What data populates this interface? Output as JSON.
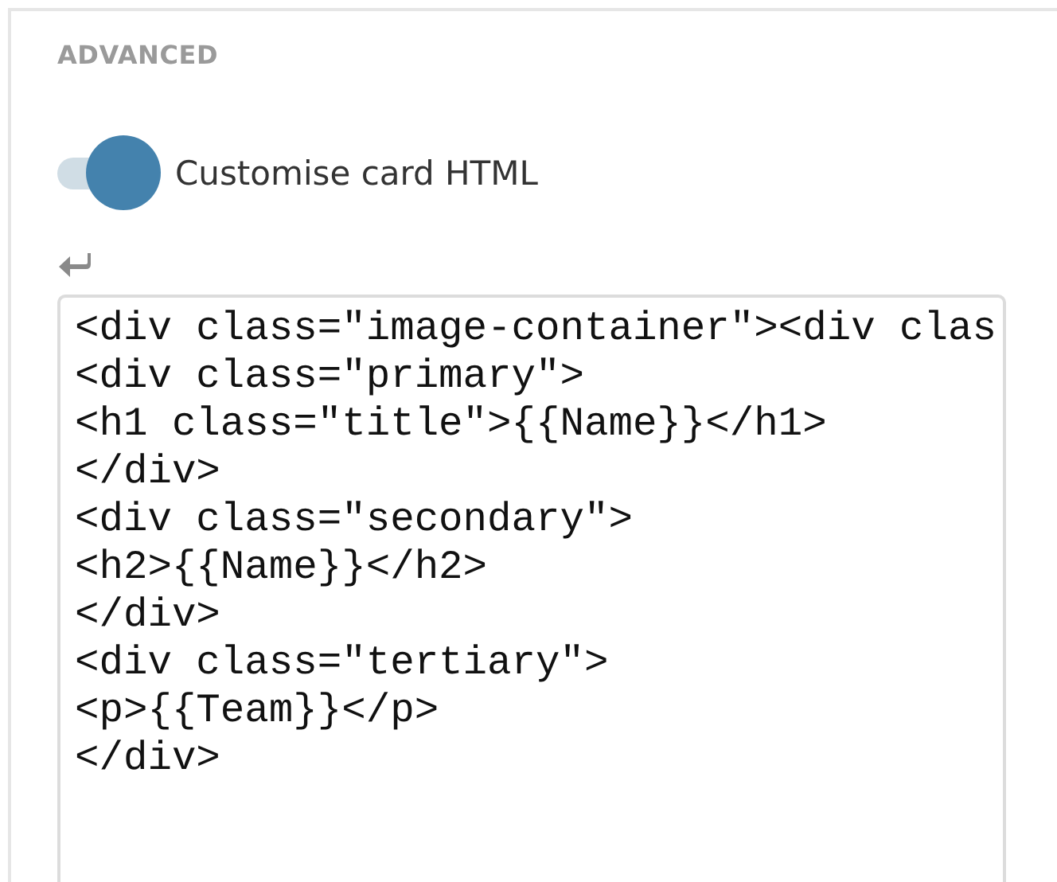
{
  "section": {
    "heading": "ADVANCED"
  },
  "toggle": {
    "label": "Customise card HTML",
    "on": true
  },
  "editor": {
    "lines": [
      "<div class=\"image-container\"><div clas",
      "<div class=\"primary\">",
      "<h1 class=\"title\">{{Name}}</h1>",
      "</div>",
      "<div class=\"secondary\">",
      "<h2>{{Name}}</h2>",
      "</div>",
      "<div class=\"tertiary\">",
      "<p>{{Team}}</p>",
      "</div>"
    ]
  }
}
